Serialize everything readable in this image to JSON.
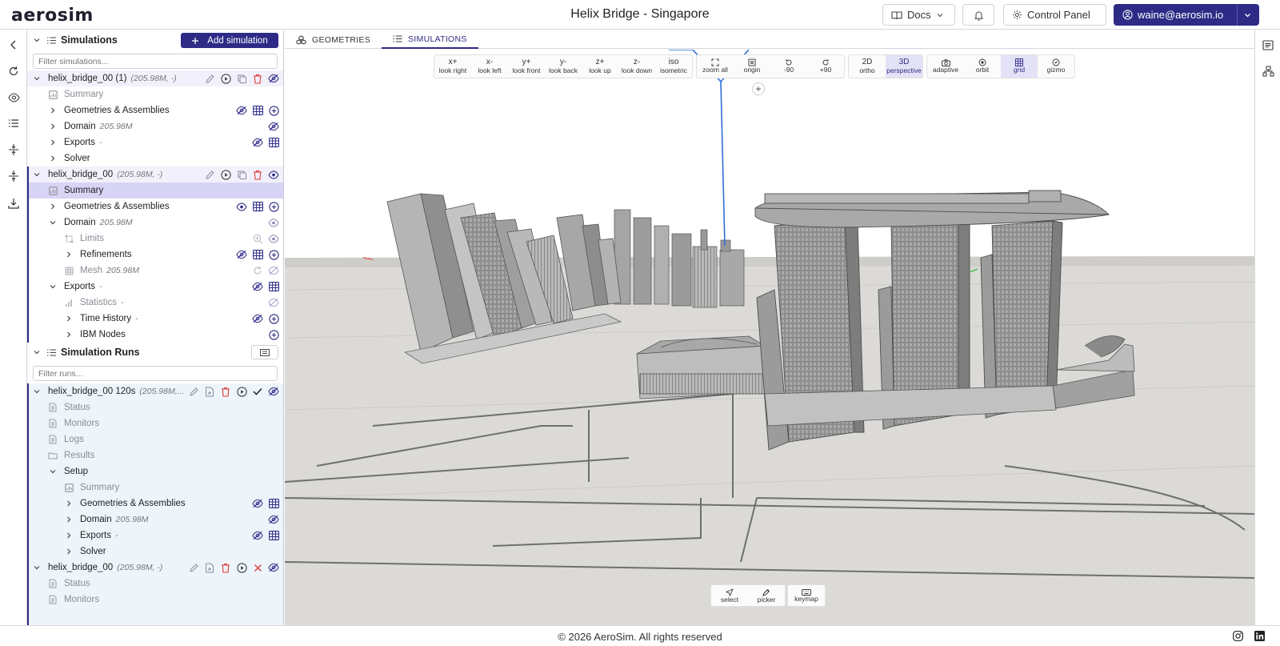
{
  "header": {
    "logo": "aerosim",
    "title": "Helix Bridge - Singapore",
    "docs_label": "Docs",
    "control_panel_label": "Control Panel",
    "user_email": "waine@aerosim.io"
  },
  "simulations_panel": {
    "title": "Simulations",
    "add_button": "Add simulation",
    "filter_placeholder": "Filter simulations...",
    "rows": [
      {
        "label": "helix_bridge_00 (1)",
        "meta": "(205.98M, -)"
      },
      {
        "label": "Summary",
        "meta": ""
      },
      {
        "label": "Geometries & Assemblies",
        "meta": ""
      },
      {
        "label": "Domain",
        "meta": "205.98M"
      },
      {
        "label": "Exports",
        "meta": "-"
      },
      {
        "label": "Solver",
        "meta": ""
      },
      {
        "label": "helix_bridge_00",
        "meta": "(205.98M, -)"
      },
      {
        "label": "Summary",
        "meta": ""
      },
      {
        "label": "Geometries & Assemblies",
        "meta": ""
      },
      {
        "label": "Domain",
        "meta": "205.98M"
      },
      {
        "label": "Limits",
        "meta": ""
      },
      {
        "label": "Refinements",
        "meta": ""
      },
      {
        "label": "Mesh",
        "meta": "205.98M"
      },
      {
        "label": "Exports",
        "meta": "-"
      },
      {
        "label": "Statistics",
        "meta": "-"
      },
      {
        "label": "Time History",
        "meta": "-"
      },
      {
        "label": "IBM Nodes",
        "meta": ""
      }
    ]
  },
  "runs_panel": {
    "title": "Simulation Runs",
    "filter_placeholder": "Filter runs...",
    "rows": [
      {
        "label": "helix_bridge_00 120s",
        "meta": "(205.98M,..."
      },
      {
        "label": "Status",
        "meta": ""
      },
      {
        "label": "Monitors",
        "meta": ""
      },
      {
        "label": "Logs",
        "meta": ""
      },
      {
        "label": "Results",
        "meta": ""
      },
      {
        "label": "Setup",
        "meta": ""
      },
      {
        "label": "Summary",
        "meta": ""
      },
      {
        "label": "Geometries & Assemblies",
        "meta": ""
      },
      {
        "label": "Domain",
        "meta": "205.98M"
      },
      {
        "label": "Exports",
        "meta": "-"
      },
      {
        "label": "Solver",
        "meta": ""
      },
      {
        "label": "helix_bridge_00",
        "meta": "(205.98M, -)"
      },
      {
        "label": "Status",
        "meta": ""
      },
      {
        "label": "Monitors",
        "meta": ""
      }
    ]
  },
  "tabs": [
    {
      "label": "GEOMETRIES",
      "icon": "cubes-icon"
    },
    {
      "label": "SIMULATIONS",
      "icon": "list-icon"
    }
  ],
  "view_toolbar": {
    "directions": [
      {
        "top": "x+",
        "bottom": "look right"
      },
      {
        "top": "x-",
        "bottom": "look left"
      },
      {
        "top": "y+",
        "bottom": "look front"
      },
      {
        "top": "y-",
        "bottom": "look back"
      },
      {
        "top": "z+",
        "bottom": "look up"
      },
      {
        "top": "z-",
        "bottom": "look down"
      },
      {
        "top": "iso",
        "bottom": "isometric"
      }
    ],
    "camera": [
      {
        "bottom": "zoom all",
        "icon": "expand-icon"
      },
      {
        "bottom": "origin",
        "icon": "target-icon"
      },
      {
        "bottom": "-90",
        "icon": "rotate-left-icon"
      },
      {
        "bottom": "+90",
        "icon": "rotate-right-icon"
      }
    ],
    "projection": [
      {
        "top": "2D",
        "bottom": "ortho"
      },
      {
        "top": "3D",
        "bottom": "perspective"
      }
    ],
    "modes": [
      {
        "bottom": "adaptive",
        "icon": "camera-icon"
      },
      {
        "bottom": "orbit",
        "icon": "orbit-icon"
      },
      {
        "bottom": "grid",
        "icon": "grid-icon"
      },
      {
        "bottom": "gizmo",
        "icon": "compass-icon"
      }
    ],
    "plus_label": "+"
  },
  "bottom_tools": [
    {
      "bottom": "select",
      "icon": "cursor-icon"
    },
    {
      "bottom": "picker",
      "icon": "eyedropper-icon"
    },
    {
      "bottom": "keymap",
      "icon": "keyboard-icon"
    }
  ],
  "footer": {
    "copyright": "© 2026 AeroSim. All rights reserved"
  },
  "colors": {
    "accent": "#2d2b86",
    "selection": "#d8d4f6",
    "danger": "#d93a3a",
    "viewport_bg": "#e6e4e1"
  }
}
